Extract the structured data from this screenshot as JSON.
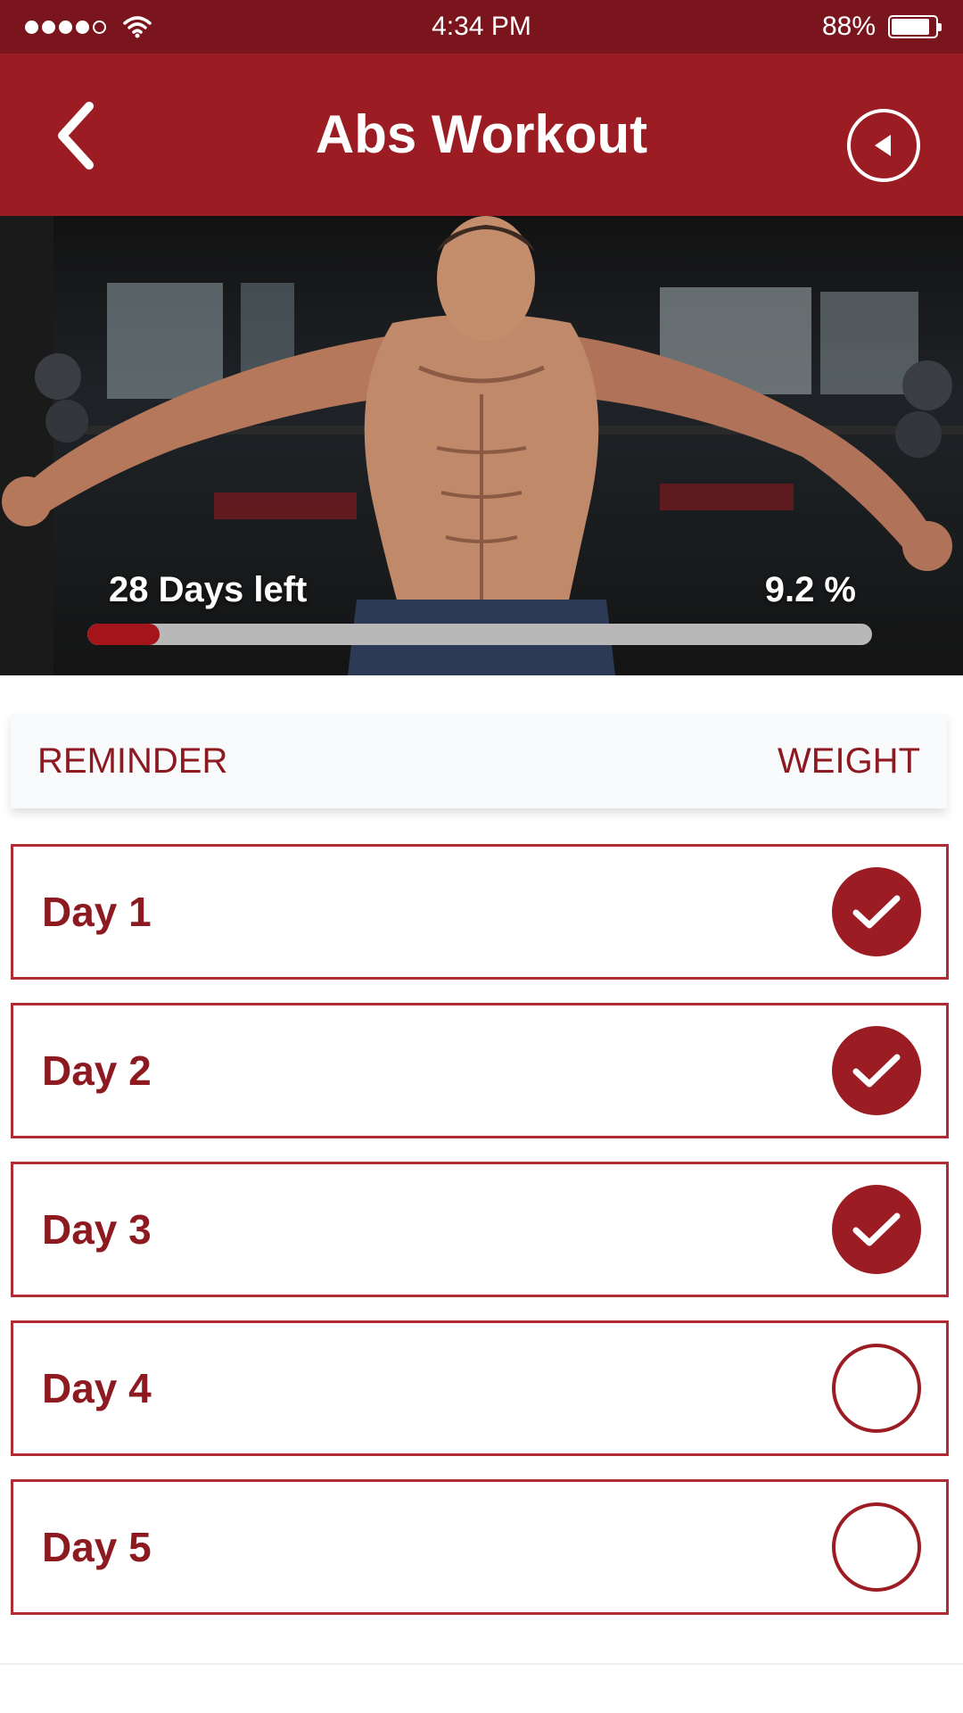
{
  "status_bar": {
    "time": "4:34 PM",
    "battery": "88%",
    "battery_level": 0.88,
    "signal_bars": 4
  },
  "app_bar": {
    "title": "Abs Workout",
    "back_icon": "chevron-left-icon",
    "play_icon": "play-reverse-icon"
  },
  "hero": {
    "days_left": "28 Days left",
    "percent_label": "9.2 %",
    "progress": 0.092
  },
  "tabs": [
    {
      "label": "REMINDER"
    },
    {
      "label": "WEIGHT"
    }
  ],
  "days": [
    {
      "label": "Day 1",
      "completed": true
    },
    {
      "label": "Day 2",
      "completed": true
    },
    {
      "label": "Day 3",
      "completed": true
    },
    {
      "label": "Day 4",
      "completed": false
    },
    {
      "label": "Day 5",
      "completed": false
    }
  ],
  "colors": {
    "primary": "#9c1c23",
    "status_bar": "#7a141d",
    "text_accent": "#8d1a20",
    "progress_track": "#b8b8b8"
  }
}
